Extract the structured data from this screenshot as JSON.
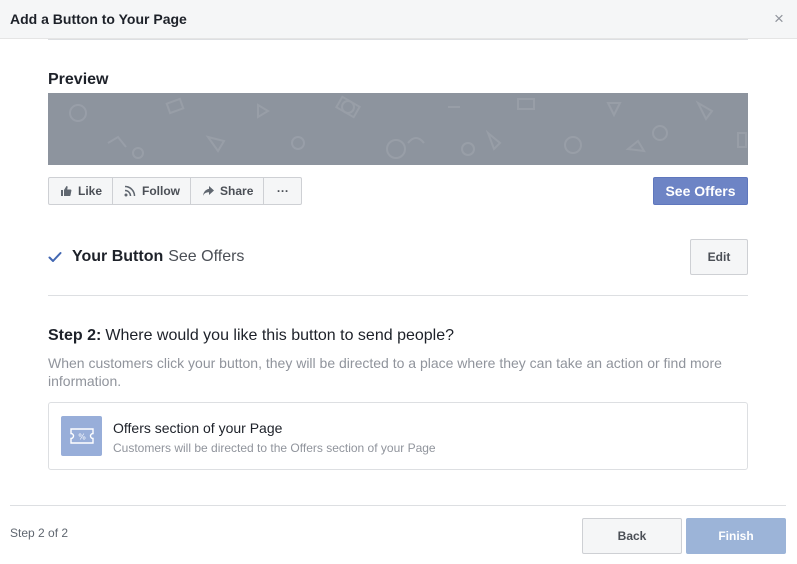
{
  "dialog": {
    "title": "Add a Button to Your Page",
    "close_glyph": "×"
  },
  "preview": {
    "title": "Preview",
    "actions": [
      {
        "label": "Like",
        "icon": "thumbs-up-icon"
      },
      {
        "label": "Follow",
        "icon": "rss-icon"
      },
      {
        "label": "Share",
        "icon": "share-arrow-icon"
      },
      {
        "label": "···",
        "icon": "more-icon"
      }
    ],
    "cta_label": "See Offers",
    "cta_color": "#6d84c5"
  },
  "your_button": {
    "label": "Your Button",
    "value": "See Offers",
    "edit_label": "Edit",
    "check_color": "#4267b2"
  },
  "step": {
    "label": "Step 2:",
    "question": "Where would you like this button to send people?",
    "description": "When customers click your button, they will be directed to a place where they can take an action or find more information."
  },
  "option": {
    "icon": "offer-ticket-icon",
    "title": "Offers section of your Page",
    "subtitle": "Customers will be directed to the Offers section of your Page"
  },
  "footer": {
    "step_count": "Step 2 of 2",
    "back_label": "Back",
    "finish_label": "Finish"
  }
}
